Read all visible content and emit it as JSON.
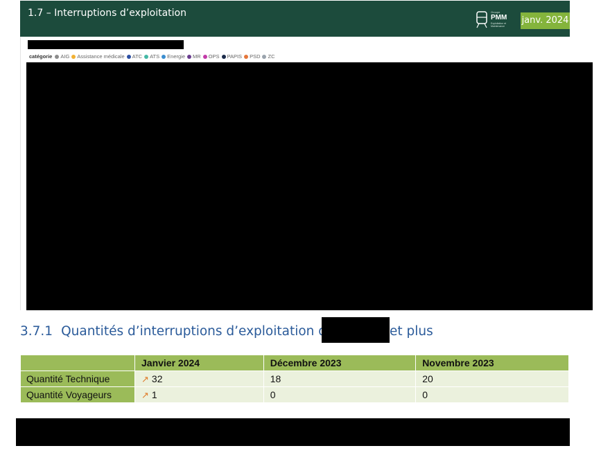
{
  "header": {
    "title": "1.7 – Interruptions d’exploitation",
    "logo": {
      "small": "Groupe",
      "big": "PMM",
      "sub": "Exploitation et Maintenance",
      "icon": "train-icon"
    },
    "date": "janv. 2024",
    "background_color": "#1c4b3c",
    "badge_color": "#84b43c"
  },
  "legend": {
    "title": "catégorie",
    "items": [
      {
        "label": "AIG",
        "color": "#8c8c8c"
      },
      {
        "label": "Assistance médicale",
        "color": "#f2b134"
      },
      {
        "label": "ATC",
        "color": "#2c4fa3"
      },
      {
        "label": "ATS",
        "color": "#44b8a5"
      },
      {
        "label": "Energie",
        "color": "#3b8ed0"
      },
      {
        "label": "MR",
        "color": "#6a3d8f"
      },
      {
        "label": "OPS",
        "color": "#c23aa8"
      },
      {
        "label": "PAPIS",
        "color": "#1b2b4a"
      },
      {
        "label": "PSD",
        "color": "#e5763a"
      },
      {
        "label": "ZC",
        "color": "#9aa3ad"
      }
    ]
  },
  "section": {
    "number": "3.7.1",
    "title_start": "Quantités d’interruptions d’exploitation de",
    "title_end": "et plus",
    "color": "#2b5b9a"
  },
  "table": {
    "columns": [
      "Janvier 2024",
      "Décembre 2023",
      "Novembre 2023"
    ],
    "rows": [
      {
        "label": "Quantité Technique",
        "trend_icon": "trend-up-icon",
        "trend_glyph": "↗",
        "values": [
          "32",
          "18",
          "20"
        ]
      },
      {
        "label": "Quantité Voyageurs",
        "trend_icon": "trend-up-icon",
        "trend_glyph": "↗",
        "values": [
          "1",
          "0",
          "0"
        ]
      }
    ],
    "header_color": "#9bbb59",
    "cell_color": "#ebf1dd",
    "trend_color": "#e07b2a"
  }
}
